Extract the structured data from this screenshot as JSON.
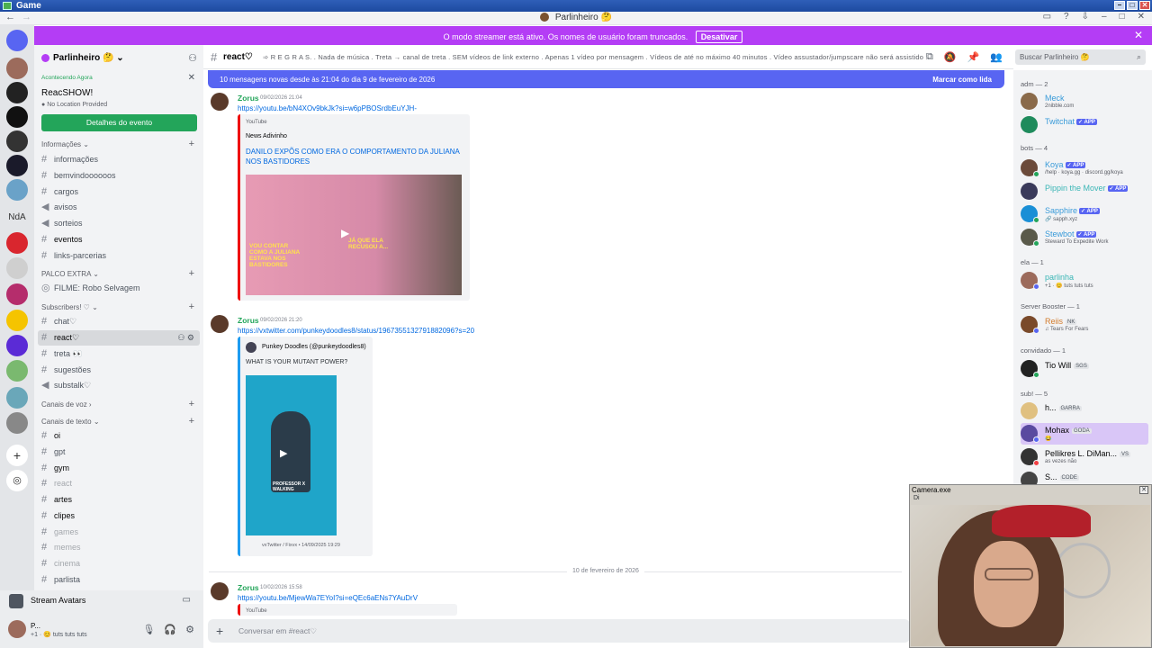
{
  "os_window": {
    "title": "Game"
  },
  "app_bar": {
    "user_name": "Parlinheiro 🤔"
  },
  "notice": {
    "message": "O modo streamer está ativo. Os nomes de usuário foram truncados.",
    "button": "Desativar"
  },
  "server": {
    "name": "Parlinheiro 🤔",
    "event": {
      "live_label": "Acontecendo Agora",
      "name": "ReacSHOW!",
      "location": "No Location Provided",
      "button": "Detalhes do evento"
    },
    "categories": {
      "informacoes": "Informações",
      "palco": "PALCO EXTRA",
      "subscribers": "Subscribers! ♡",
      "voz": "Canais de voz",
      "texto": "Canais de texto"
    },
    "channels": [
      "informações",
      "bemvindoooooos",
      "cargos",
      "avisos",
      "sorteios",
      "eventos",
      "links-parcerias",
      "FILME: Robo Selvagem",
      "chat♡",
      "react♡",
      "treta 👀",
      "sugestões",
      "substalk♡",
      "oi",
      "gpt",
      "gym",
      "react",
      "artes",
      "clipes",
      "games",
      "memes",
      "cinema",
      "parlista"
    ]
  },
  "stream_avatars": {
    "label": "Stream Avatars"
  },
  "user_panel": {
    "name": "P...",
    "status": "+1 · 😊 tuts tuts tuts"
  },
  "chat": {
    "channel": "react♡",
    "topic": "➾ R E G R A S. . Nada de música . Treta → canal de treta . SEM vídeos de link externo . Apenas 1 vídeo por mensagem . Vídeos de até no máximo 40 minutos . Vídeo assustador/jumpscare não será assistido . . .",
    "search_placeholder": "Buscar Parlinheiro 🤔",
    "new_messages": "10 mensagens novas desde às 21:04 do dia 9 de fevereiro de 2026",
    "mark_read": "Marcar como lida",
    "date_divider": "10 de fevereiro de 2026",
    "composer_placeholder": "Conversar em #react♡",
    "messages": [
      {
        "author": "Zorus",
        "time": "09/02/2026 21:04",
        "link": "https://youtu.be/bN4XOv9bkJk?si=w6pPBOSrdbEuYJH-",
        "embed": {
          "provider": "YouTube",
          "author": "News Adivinho",
          "title": "DANILO EXPÕS COMO ERA O COMPORTAMENTO DA JULIANA NOS BASTIDORES",
          "thumb_caption": "VOU CONTAR COMO A JULIANA ESTAVA NOS BASTIDORES",
          "thumb_caption2": "JÁ QUE ELA RECUSOU A..."
        }
      },
      {
        "author": "Zorus",
        "time": "09/02/2026 21:20",
        "link": "https://vxtwitter.com/punkeydoodles8/status/1967355132791882096?s=20",
        "embed": {
          "author": "Punkey Doodles (@punkeydoodles8)",
          "description": "WHAT IS YOUR MUTANT POWER?",
          "footer": "vxTwitter / Fixvx • 14/09/2025 19:29",
          "image_caption": "PROFESSOR X WALKING"
        }
      },
      {
        "author": "Zorus",
        "time": "10/02/2026 15:58",
        "link": "https://youtu.be/MjewWa7EYoI?si=eQEc6aENs7YAuDrV",
        "embed": {
          "provider": "YouTube"
        }
      }
    ]
  },
  "members": {
    "groups": [
      {
        "label": "adm — 2"
      },
      {
        "label": "bots — 4"
      },
      {
        "label": "ela — 1"
      },
      {
        "label": "Server Booster — 1"
      },
      {
        "label": "convidado — 1"
      },
      {
        "label": "sub! — 5"
      }
    ],
    "list": [
      {
        "name": "Meck",
        "sub": "2nibble.com",
        "color": "#3a9bd9"
      },
      {
        "name": "Twitchat",
        "badge": "✓ APP",
        "color": "#3a9bd9"
      },
      {
        "name": "Koya",
        "badge": "✓ APP",
        "sub": "/help · koya.gg · discord.gg/koya",
        "color": "#3a9bd9"
      },
      {
        "name": "Pippin the Mover",
        "badge": "✓ APP",
        "color": "#3bb6b6"
      },
      {
        "name": "Sapphire",
        "badge": "✓ APP",
        "sub": "🔗 sapph.xyz",
        "color": "#3a9bd9"
      },
      {
        "name": "Stewbot",
        "badge": "✓ APP",
        "sub": "Steward To Expedite Work",
        "color": "#3a9bd9"
      },
      {
        "name": "parlinha",
        "sub": "+1 · 😊 tuts tuts tuts",
        "color": "#3bb6b6"
      },
      {
        "name": "Reiis",
        "tag": "NK",
        "sub": "♫ Tears For Fears",
        "color": "#d27b2c"
      },
      {
        "name": "Tio Will",
        "tag": "SGS",
        "color": "#060607"
      },
      {
        "name": "h...",
        "tag": "GARRA",
        "color": "#060607"
      },
      {
        "name": "Mohax",
        "tag": "GODA",
        "sub": "😂",
        "color": "#060607"
      },
      {
        "name": "Pellikres L. DiMan...",
        "tag": "VS",
        "sub": "as vezes não",
        "color": "#060607"
      },
      {
        "name": "S...",
        "tag": "CODE",
        "color": "#060607"
      }
    ]
  },
  "camera": {
    "title": "Camera.exe",
    "menu": "Di"
  },
  "colors": {
    "accent": "#5865f2",
    "streamer_bar": "#b43df5",
    "online": "#23a55a"
  }
}
